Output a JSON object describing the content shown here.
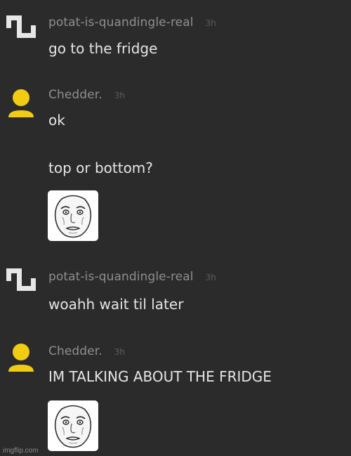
{
  "colors": {
    "background": "#2b2b2b",
    "username": "#8f8f8f",
    "timestamp": "#5d5d5d",
    "message_text": "#e6e6e6",
    "cheese_avatar": "#f1cc13",
    "potat_avatar": "#e7e7e7"
  },
  "messages": [
    {
      "avatar_icon": "potat-pixel-logo-icon",
      "username": "potat-is-quandingle-real",
      "time": "3h",
      "lines": [
        "go to the fridge"
      ]
    },
    {
      "avatar_icon": "yellow-person-icon",
      "username": "Chedder.",
      "time": "3h",
      "lines": [
        "ok",
        "top or bottom?"
      ],
      "sticker_icon": "okay-guy-meme-face-icon"
    },
    {
      "avatar_icon": "potat-pixel-logo-icon",
      "username": "potat-is-quandingle-real",
      "time": "3h",
      "lines": [
        "woahh wait til later"
      ]
    },
    {
      "avatar_icon": "yellow-person-icon",
      "username": "Chedder.",
      "time": "3h",
      "lines": [
        "IM TALKING ABOUT THE FRIDGE"
      ],
      "sticker_icon": "okay-guy-meme-face-icon"
    }
  ],
  "watermark": "imgflip.com"
}
